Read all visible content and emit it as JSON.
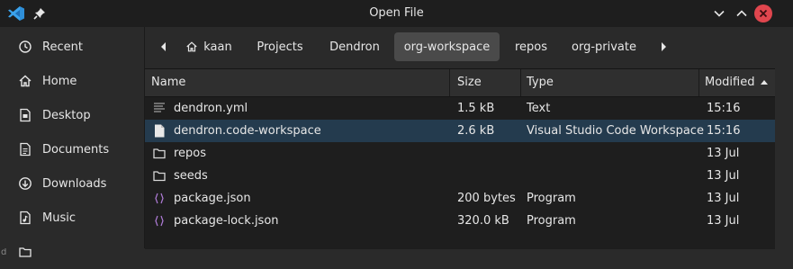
{
  "window": {
    "title": "Open File",
    "icons": {
      "app": "vscode-logo-icon",
      "pin": "pin-icon",
      "minimize": "chevron-down-icon",
      "maximize": "chevron-up-icon",
      "close": "close-icon"
    }
  },
  "sidebar": {
    "items": [
      {
        "label": "Recent",
        "icon": "clock-icon"
      },
      {
        "label": "Home",
        "icon": "home-icon"
      },
      {
        "label": "Desktop",
        "icon": "desktop-icon"
      },
      {
        "label": "Documents",
        "icon": "documents-icon"
      },
      {
        "label": "Downloads",
        "icon": "downloads-icon"
      },
      {
        "label": "Music",
        "icon": "music-icon"
      }
    ]
  },
  "path_bar": {
    "crumbs": [
      {
        "label": "kaan",
        "icon": "home-icon"
      },
      {
        "label": "Projects"
      },
      {
        "label": "Dendron"
      },
      {
        "label": "org-workspace",
        "active": true
      },
      {
        "label": "repos"
      },
      {
        "label": "org-private"
      }
    ]
  },
  "file_list": {
    "columns": [
      "Name",
      "Size",
      "Type",
      "Modified"
    ],
    "sort_column": "Modified",
    "rows": [
      {
        "name": "dendron.yml",
        "size": "1.5 kB",
        "type": "Text",
        "modified": "15:16",
        "icon": "text-file-icon"
      },
      {
        "name": "dendron.code-workspace",
        "size": "2.6 kB",
        "type": "Visual Studio Code Workspace",
        "modified": "15:16",
        "icon": "file-icon",
        "selected": true
      },
      {
        "name": "repos",
        "size": "",
        "type": "",
        "modified": "13 Jul",
        "icon": "folder-icon"
      },
      {
        "name": "seeds",
        "size": "",
        "type": "",
        "modified": "13 Jul",
        "icon": "folder-icon"
      },
      {
        "name": "package.json",
        "size": "200 bytes",
        "type": "Program",
        "modified": "13 Jul",
        "icon": "code-file-icon"
      },
      {
        "name": "package-lock.json",
        "size": "320.0 kB",
        "type": "Program",
        "modified": "13 Jul",
        "icon": "code-file-icon"
      }
    ]
  },
  "colors": {
    "selection": "#243b4e",
    "close_button": "#e0464e",
    "vscode_blue": "#2f8fd8",
    "code_icon": "#b07cd8"
  }
}
